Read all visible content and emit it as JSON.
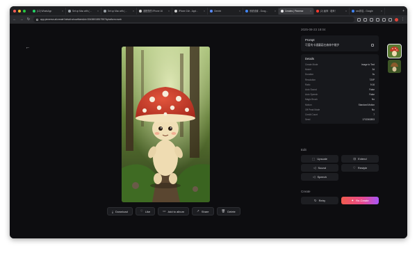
{
  "colors": {
    "accent_gradient_start": "#f05b4f",
    "accent_gradient_end": "#a855f7",
    "traffic_red": "#ff5f57",
    "traffic_yellow": "#febc2e",
    "traffic_green": "#28c840"
  },
  "browser": {
    "tabs": [
      {
        "label": "(12) WhatsApp",
        "favicon_color": "#25d366"
      },
      {
        "label": "Set up Mac with (…",
        "favicon_color": "#9aa0a6"
      },
      {
        "label": "Set up Mac with (…",
        "favicon_color": "#9aa0a6"
      },
      {
        "label": "选配您的 iPhone 16",
        "favicon_color": "#cfcfcf"
      },
      {
        "label": "iPhone 16e - Appl…",
        "favicon_color": "#cfcfcf"
      },
      {
        "label": "Gemini",
        "favicon_color": "#5b8cff"
      },
      {
        "label": "系统设置 - Goog…",
        "favicon_color": "#4285f4"
      },
      {
        "label": "Creates | Pinnerse",
        "favicon_color": "#e8e8ea",
        "active": true
      },
      {
        "label": "(2) 画师 · 老师！",
        "favicon_color": "#ff3b30"
      },
      {
        "label": "seo排名 - Google",
        "favicon_color": "#4285f4"
      }
    ],
    "new_tab": "+",
    "url": "app.pinnerse.ai/create?detail=showMain&id=33438018517557&platform=web",
    "nav": {
      "back": "←",
      "forward": "→",
      "reload": "↻"
    }
  },
  "page": {
    "back_icon": "←",
    "image_actions": [
      {
        "label": "Download",
        "icon": "download-icon",
        "glyph": "⤓"
      },
      {
        "label": "Like",
        "icon": "heart-icon",
        "glyph": "♡"
      },
      {
        "label": "Add to album",
        "icon": "folder-icon",
        "glyph": "▭"
      },
      {
        "label": "Share",
        "icon": "share-icon",
        "glyph": "↗"
      },
      {
        "label": "Delete",
        "icon": "trash-icon",
        "glyph": "🗑"
      }
    ]
  },
  "panel": {
    "timestamp": "2025-08-23 18:04",
    "prompt_title": "Prompt",
    "prompt_text": "可爱的卡通蘑菇在森林中散步",
    "details_title": "Details",
    "details": [
      {
        "key": "Create Mode",
        "value": "Image to Text"
      },
      {
        "key": "Model",
        "value": "3d"
      },
      {
        "key": "Duration",
        "value": "3s"
      },
      {
        "key": "Resolution",
        "value": "720P"
      },
      {
        "key": "Ratio",
        "value": "9:16"
      },
      {
        "key": "Auto Sound",
        "value": "False"
      },
      {
        "key": "Auto Speech",
        "value": "False"
      },
      {
        "key": "Magic Brush",
        "value": "No"
      },
      {
        "key": "Motion",
        "value": "Standard Motion"
      },
      {
        "key": "Off Peak Mode",
        "value": "No"
      },
      {
        "key": "Credit Count",
        "value": "7"
      },
      {
        "key": "Seed",
        "value": "1702363893"
      }
    ],
    "edit_title": "Edit",
    "edit_buttons": [
      {
        "label": "Upscale",
        "glyph": "⬚"
      },
      {
        "label": "Extend",
        "glyph": "⊡"
      },
      {
        "label": "Sound",
        "glyph": "◁"
      },
      {
        "label": "Restyle",
        "glyph": "♡"
      },
      {
        "label": "Speech",
        "glyph": "◁"
      }
    ],
    "create_title": "Create",
    "retry_label": "Retry",
    "retry_glyph": "↻",
    "recreate_label": "Re-Create",
    "recreate_glyph": "✦"
  }
}
